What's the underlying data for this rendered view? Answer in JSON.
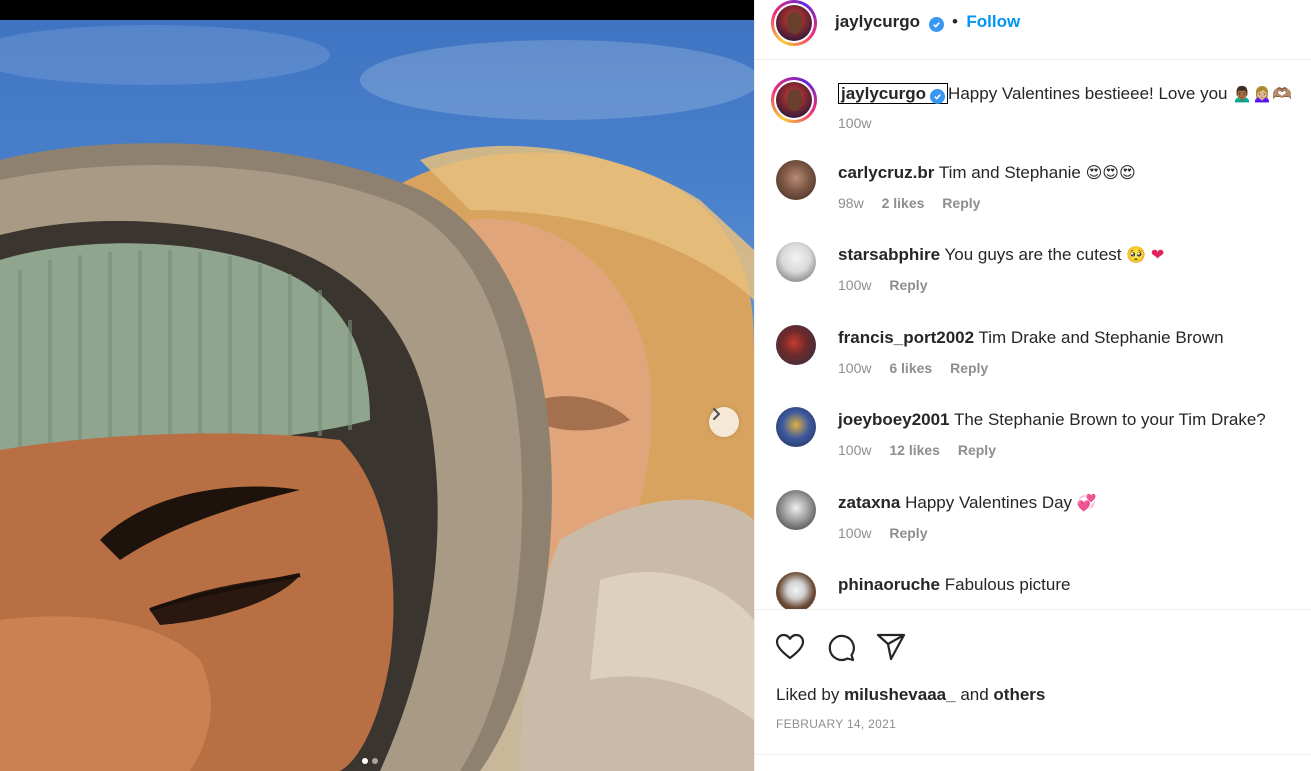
{
  "post": {
    "author": "jaylycurgo",
    "follow_label": "Follow",
    "caption_user": "jaylycurgo",
    "caption_text": "Happy Valentines bestieee! Love you",
    "caption_emojis": "🙍🏾‍♂️🙍🏼‍♀️🫶🏽",
    "caption_age": "100w",
    "liked_by_prefix": "Liked by",
    "liked_by_user": "milushevaaa_",
    "liked_by_and": "and",
    "liked_by_others": "others",
    "date": "FEBRUARY 14, 2021"
  },
  "comments": [
    {
      "user": "carlycruz.br",
      "text": "Tim and Stephanie",
      "emoji": "😍😍😍",
      "age": "98w",
      "likes": "2 likes",
      "reply": "Reply"
    },
    {
      "user": "starsabphire",
      "text": "You guys are the cutest",
      "emoji": "🥺",
      "heart": "❤",
      "age": "100w",
      "reply": "Reply"
    },
    {
      "user": "francis_port2002",
      "text": "Tim Drake and Stephanie Brown",
      "age": "100w",
      "likes": "6 likes",
      "reply": "Reply"
    },
    {
      "user": "joeyboey2001",
      "text": "The Stephanie Brown to your Tim Drake?",
      "age": "100w",
      "likes": "12 likes",
      "reply": "Reply"
    },
    {
      "user": "zataxna",
      "text": "Happy Valentines Day",
      "emoji": "💞",
      "age": "100w",
      "reply": "Reply"
    },
    {
      "user": "phinaoruche",
      "text": "Fabulous picture"
    }
  ],
  "carousel": {
    "total_slides": 2,
    "active_index": 0
  },
  "icons": {
    "next": "chevron-right-icon",
    "like": "heart-icon",
    "comment": "comment-icon",
    "share": "paper-plane-icon",
    "verified": "verified-badge-icon"
  },
  "colors": {
    "accent": "#0095f6",
    "verified": "#3897f0",
    "muted": "#8e8e8e",
    "text": "#262626"
  }
}
